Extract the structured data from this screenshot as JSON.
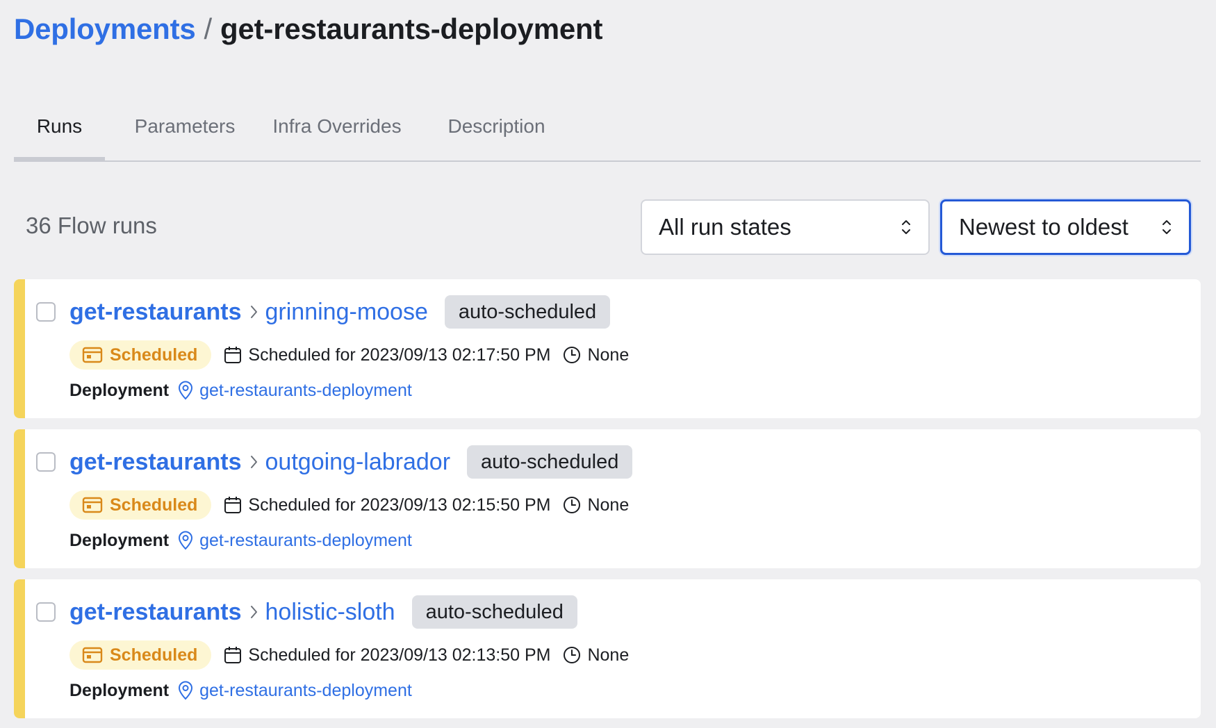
{
  "breadcrumb": {
    "root": "Deployments",
    "separator": "/",
    "current": "get-restaurants-deployment"
  },
  "tabs": [
    {
      "label": "Runs",
      "active": true
    },
    {
      "label": "Parameters",
      "active": false
    },
    {
      "label": "Infra Overrides",
      "active": false
    },
    {
      "label": "Description",
      "active": false
    }
  ],
  "toolbar": {
    "count_label": "36 Flow runs",
    "state_filter": "All run states",
    "sort_order": "Newest to oldest"
  },
  "runs": [
    {
      "flow": "get-restaurants",
      "name": "grinning-moose",
      "tag": "auto-scheduled",
      "state": "Scheduled",
      "scheduled": "Scheduled for 2023/09/13 02:17:50 PM",
      "duration": "None",
      "deployment_label": "Deployment",
      "deployment": "get-restaurants-deployment"
    },
    {
      "flow": "get-restaurants",
      "name": "outgoing-labrador",
      "tag": "auto-scheduled",
      "state": "Scheduled",
      "scheduled": "Scheduled for 2023/09/13 02:15:50 PM",
      "duration": "None",
      "deployment_label": "Deployment",
      "deployment": "get-restaurants-deployment"
    },
    {
      "flow": "get-restaurants",
      "name": "holistic-sloth",
      "tag": "auto-scheduled",
      "state": "Scheduled",
      "scheduled": "Scheduled for 2023/09/13 02:13:50 PM",
      "duration": "None",
      "deployment_label": "Deployment",
      "deployment": "get-restaurants-deployment"
    }
  ],
  "icons": {
    "sort": "chevron-up-down-icon",
    "breadcrumb_chevron": "chevron-right-icon",
    "state": "calendar-card-icon",
    "date": "calendar-icon",
    "duration": "clock-icon",
    "deployment": "map-pin-icon"
  },
  "colors": {
    "link": "#2f6fe4",
    "scheduled_bar": "#f5d45b",
    "scheduled_badge_bg": "#fdf6d3",
    "scheduled_badge_text": "#d9891a",
    "tag_bg": "#dddfe4",
    "focus_border": "#2459d6"
  }
}
